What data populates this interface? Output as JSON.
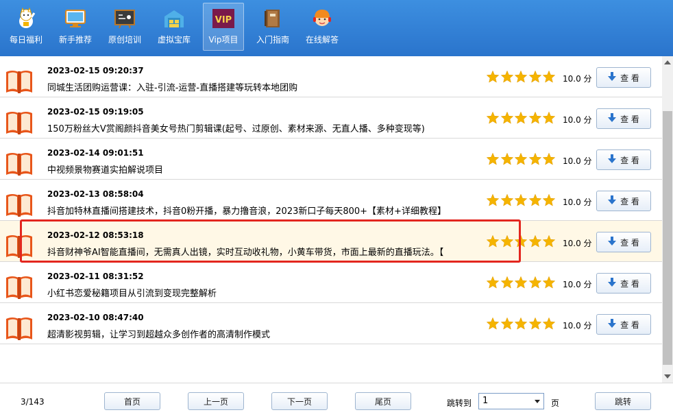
{
  "toolbar": {
    "items": [
      {
        "label": "每日福利",
        "icon": "lucky-cat-icon"
      },
      {
        "label": "新手推荐",
        "icon": "monitor-icon"
      },
      {
        "label": "原创培训",
        "icon": "blackboard-icon"
      },
      {
        "label": "虚拟宝库",
        "icon": "warehouse-icon"
      },
      {
        "label": "Vip项目",
        "icon": "vip-icon",
        "badge": "VIP"
      },
      {
        "label": "入门指南",
        "icon": "book-guide-icon"
      },
      {
        "label": "在线解答",
        "icon": "support-agent-icon"
      }
    ],
    "active_index": 4
  },
  "list": {
    "rows": [
      {
        "date": "2023-02-15 09:20:37",
        "title": "同城生活团购运营课：入驻-引流-运营-直播搭建等玩转本地团购",
        "score": "10.0 分",
        "view": "查 看"
      },
      {
        "date": "2023-02-15 09:19:05",
        "title": "150万粉丝大V赏阁颜抖音美女号热门剪辑课(起号、过原创、素材来源、无直人播、多种变现等)",
        "score": "10.0 分",
        "view": "查 看"
      },
      {
        "date": "2023-02-14 09:01:51",
        "title": "中视频景物赛道实拍解说项目",
        "score": "10.0 分",
        "view": "查 看"
      },
      {
        "date": "2023-02-13 08:58:04",
        "title": "抖音加特林直播间搭建技术，抖音0粉开播，暴力撸音浪，2023新口子每天800+【素材+详细教程】",
        "score": "10.0 分",
        "view": "查 看"
      },
      {
        "date": "2023-02-12 08:53:18",
        "title": "抖音财神爷AI智能直播间，无需真人出镜，实时互动收礼物，小黄车带货，市面上最新的直播玩法。【",
        "score": "10.0 分",
        "view": "查 看"
      },
      {
        "date": "2023-02-11 08:31:52",
        "title": "小红书恋爱秘籍项目从引流到变现完整解析",
        "score": "10.0 分",
        "view": "查 看"
      },
      {
        "date": "2023-02-10 08:47:40",
        "title": "超清影视剪辑，让学习到超越众多创作者的高清制作模式",
        "score": "10.0 分",
        "view": "查 看"
      }
    ],
    "selected_index": 4,
    "stars_per_row": 5
  },
  "footer": {
    "page_count": "3/143",
    "first": "首页",
    "prev": "上一页",
    "next": "下一页",
    "last": "尾页",
    "goto_label": "跳转到",
    "goto_value": "1",
    "unit": "页",
    "jump": "跳转"
  },
  "colors": {
    "toolbar": "#2a74cc",
    "star": "#f5b400",
    "book": "#e8561a",
    "highlight": "#e3261f",
    "selected_row": "#fff8e6"
  }
}
